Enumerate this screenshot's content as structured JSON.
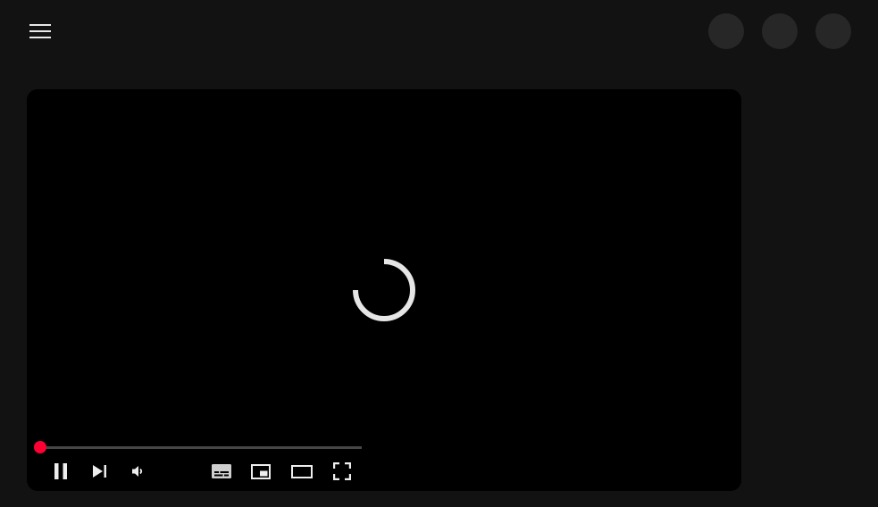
{
  "topbar": {
    "menu_icon": "hamburger-menu-icon",
    "buttons": [
      {
        "name": "account-circle-button-1"
      },
      {
        "name": "account-circle-button-2"
      },
      {
        "name": "account-circle-button-3"
      }
    ]
  },
  "player": {
    "state": "loading",
    "progress_fraction": 0.0,
    "accent_color": "#ff0033",
    "controls": {
      "play_pause_icon": "pause-icon",
      "next_icon": "skip-next-icon",
      "volume_icon": "volume-icon",
      "captions_icon": "captions-icon",
      "miniplayer_icon": "miniplayer-icon",
      "theater_icon": "theater-mode-icon",
      "fullscreen_icon": "fullscreen-icon"
    }
  }
}
